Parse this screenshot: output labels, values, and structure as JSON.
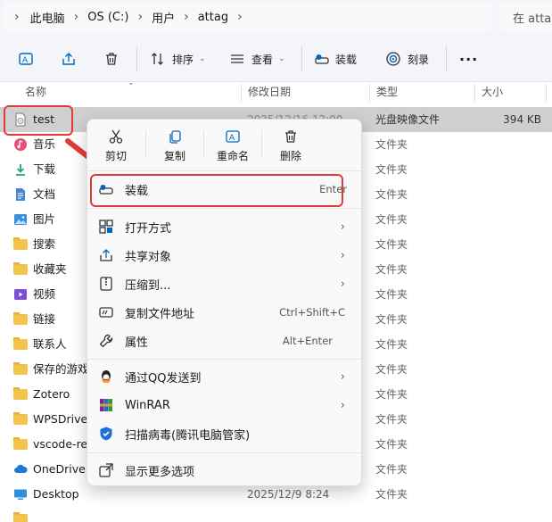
{
  "address": {
    "crumbs": [
      "此电脑",
      "OS (C:)",
      "用户",
      "attag"
    ],
    "search_placeholder": "在 attag"
  },
  "toolbar": {
    "sort_label": "排序",
    "view_label": "查看",
    "mount_label": "装载",
    "burn_label": "刻录",
    "more_label": "···"
  },
  "columns": {
    "name": "名称",
    "date": "修改日期",
    "type": "类型",
    "size": "大小"
  },
  "files": [
    {
      "name": "test",
      "date": "2025/12/16 12:00",
      "type": "光盘映像文件",
      "size": "394 KB",
      "icon": "disc-image-icon"
    },
    {
      "name": "音乐",
      "date": "",
      "type": "文件夹",
      "size": "",
      "icon": "music-folder-icon"
    },
    {
      "name": "下载",
      "date": "",
      "type": "文件夹",
      "size": "",
      "icon": "download-folder-icon"
    },
    {
      "name": "文档",
      "date": "",
      "type": "文件夹",
      "size": "",
      "icon": "documents-folder-icon"
    },
    {
      "name": "图片",
      "date": "",
      "type": "文件夹",
      "size": "",
      "icon": "pictures-folder-icon"
    },
    {
      "name": "搜索",
      "date": "",
      "type": "文件夹",
      "size": "",
      "icon": "folder-icon"
    },
    {
      "name": "收藏夹",
      "date": "",
      "type": "文件夹",
      "size": "",
      "icon": "folder-icon"
    },
    {
      "name": "视频",
      "date": "",
      "type": "文件夹",
      "size": "",
      "icon": "videos-folder-icon"
    },
    {
      "name": "链接",
      "date": "",
      "type": "文件夹",
      "size": "",
      "icon": "folder-icon"
    },
    {
      "name": "联系人",
      "date": "",
      "type": "文件夹",
      "size": "",
      "icon": "folder-icon"
    },
    {
      "name": "保存的游戏",
      "date": "",
      "type": "文件夹",
      "size": "",
      "icon": "folder-icon"
    },
    {
      "name": "Zotero",
      "date": "",
      "type": "文件夹",
      "size": "",
      "icon": "folder-icon"
    },
    {
      "name": "WPSDrive",
      "date": "",
      "type": "文件夹",
      "size": "",
      "icon": "folder-icon"
    },
    {
      "name": "vscode-remote",
      "date": "",
      "type": "文件夹",
      "size": "",
      "icon": "folder-icon"
    },
    {
      "name": "OneDrive",
      "date": "",
      "type": "文件夹",
      "size": "",
      "icon": "onedrive-icon"
    },
    {
      "name": "Desktop",
      "date": "2025/12/9 8:24",
      "type": "文件夹",
      "size": "",
      "icon": "desktop-folder-icon"
    }
  ],
  "context_menu": {
    "actions": [
      {
        "label": "剪切",
        "icon": "scissors-icon"
      },
      {
        "label": "复制",
        "icon": "copy-icon"
      },
      {
        "label": "重命名",
        "icon": "rename-icon"
      },
      {
        "label": "删除",
        "icon": "trash-icon"
      }
    ],
    "items": [
      {
        "label": "装载",
        "shortcut": "Enter",
        "icon": "mount-icon"
      },
      {
        "label": "打开方式",
        "shortcut": "",
        "icon": "open-with-icon",
        "submenu": true
      },
      {
        "label": "共享对象",
        "shortcut": "",
        "icon": "share-icon",
        "submenu": true
      },
      {
        "label": "压缩到...",
        "shortcut": "",
        "icon": "compress-icon",
        "submenu": true
      },
      {
        "label": "复制文件地址",
        "shortcut": "Ctrl+Shift+C",
        "icon": "copy-path-icon"
      },
      {
        "label": "属性",
        "shortcut": "Alt+Enter",
        "icon": "properties-icon"
      },
      {
        "label": "通过QQ发送到",
        "shortcut": "",
        "icon": "qq-icon",
        "submenu": true
      },
      {
        "label": "WinRAR",
        "shortcut": "",
        "icon": "winrar-icon",
        "submenu": true
      },
      {
        "label": "扫描病毒(腾讯电脑管家)",
        "shortcut": "",
        "icon": "shield-scan-icon"
      },
      {
        "label": "显示更多选项",
        "shortcut": "",
        "icon": "more-options-icon"
      }
    ]
  },
  "colors": {
    "accent": "#0067c0",
    "highlight_red": "#e03b3b",
    "selected_row": "#cfcfcf",
    "folder": "#f2c44c"
  }
}
